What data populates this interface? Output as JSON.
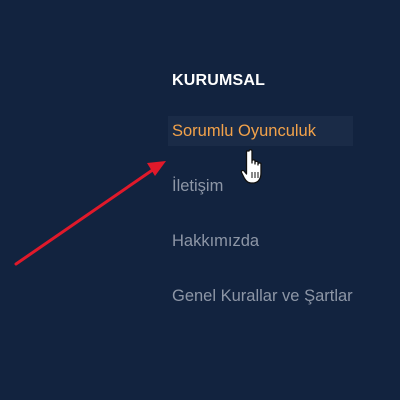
{
  "footer": {
    "section_title": "KURUMSAL",
    "items": [
      {
        "label": "Sorumlu Oyunculuk",
        "active": true
      },
      {
        "label": "İletişim",
        "active": false
      },
      {
        "label": "Hakkımızda",
        "active": false
      },
      {
        "label": "Genel Kurallar ve Şartlar",
        "active": false
      }
    ]
  },
  "colors": {
    "background": "#12233f",
    "title": "#ffffff",
    "link": "#8d96a6",
    "link_hover": "#f2a24a",
    "arrow": "#e0192a"
  },
  "icons": {
    "cursor": "hand-pointer-icon",
    "annotation": "red-arrow-icon"
  }
}
